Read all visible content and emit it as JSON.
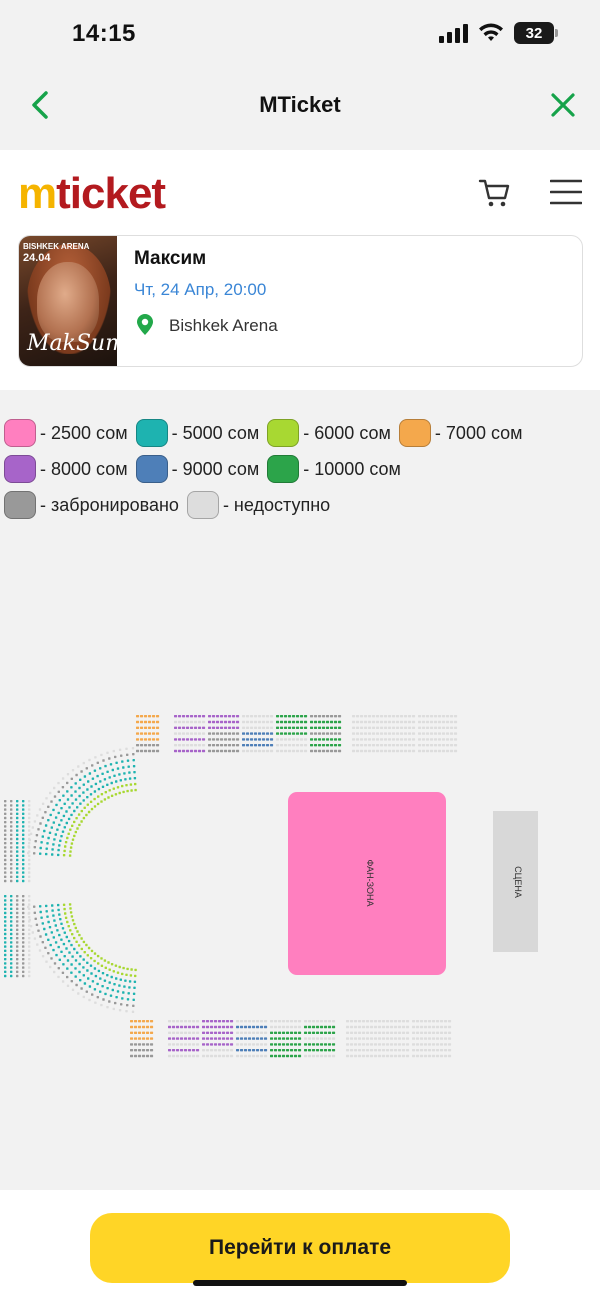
{
  "status_bar": {
    "time": "14:15",
    "battery": "32"
  },
  "nav": {
    "title": "MTicket",
    "back_icon": "chevron-left-icon",
    "close_icon": "close-icon"
  },
  "header": {
    "logo_m": "m",
    "logo_rest": "ticket",
    "cart_icon": "cart-icon",
    "menu_icon": "hamburger-menu-icon"
  },
  "event": {
    "name": "Максим",
    "date": "Чт, 24 Апр, 20:00",
    "venue": "Bishkek Arena",
    "poster_venue": "BISHKEK ARENA",
    "poster_date": "24.04",
    "poster_signature": "MakSum"
  },
  "legend": [
    {
      "label": "- 2500 сом",
      "color": "#ff7fbf"
    },
    {
      "label": "- 5000 сом",
      "color": "#1eb3b0"
    },
    {
      "label": "- 6000 сом",
      "color": "#a8d832"
    },
    {
      "label": "- 7000 сом",
      "color": "#f4a84c"
    },
    {
      "label": "- 8000 сом",
      "color": "#a764c9"
    },
    {
      "label": "- 9000 сом",
      "color": "#4e7fb8"
    },
    {
      "label": "- 10000 сом",
      "color": "#2ca44a"
    },
    {
      "label": "- забронировано",
      "color": "#999999"
    },
    {
      "label": "- недоступно",
      "color": "#dddddd"
    }
  ],
  "seat_map": {
    "fan_zone_label": "ФАН-ЗОНА",
    "stage_label": "СЦЕНА",
    "fan_zone_color": "#ff7fbf",
    "stage_color": "#d8d8d8"
  },
  "footer": {
    "pay_label": "Перейти к оплате"
  }
}
